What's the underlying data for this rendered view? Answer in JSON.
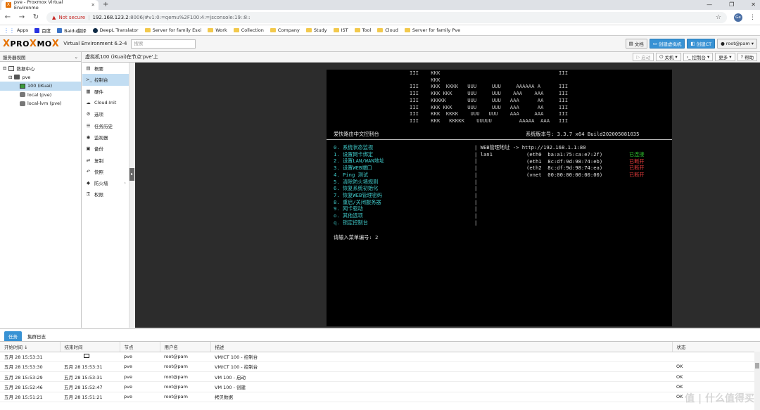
{
  "browser": {
    "tab_title": "pve - Proxmox Virtual Environme",
    "security_label": "Not secure",
    "url_host": "192.168.123.2",
    "url_rest": ":8006/#v1:0:=qemu%2F100:4:=jsconsole:19::8::",
    "profile_initials": "Ge",
    "bookmarks": [
      "Apps",
      "百度",
      "Baidu翻译",
      "DeepL Translator",
      "Server for family Esxi",
      "Work",
      "Collection",
      "Company",
      "Study",
      "IST",
      "Tool",
      "Cloud",
      "Server for family Pve"
    ]
  },
  "header": {
    "logo_left": "PRO",
    "logo_x": "X",
    "logo_mid": "MO",
    "logo_x2": "X",
    "version": "Virtual Environment 6.2-4",
    "search_placeholder": "搜索",
    "docs": "文档",
    "create_vm": "创建虚拟机",
    "create_ct": "创建CT",
    "user": "root@pam"
  },
  "tree": {
    "view_label": "服务器视图",
    "items": [
      {
        "label": "数据中心"
      },
      {
        "label": "pve"
      },
      {
        "label": "100 (iKuai)"
      },
      {
        "label": "local (pve)"
      },
      {
        "label": "local-lvm (pve)"
      }
    ]
  },
  "content": {
    "title": "虚拟机100 (iKuai)在节点'pve'上",
    "buttons": {
      "start": "启动",
      "shutdown": "关机",
      "console": "控制台",
      "more": "更多",
      "help": "帮助"
    }
  },
  "menu": [
    {
      "label": "概要",
      "icon": "▤"
    },
    {
      "label": "控制台",
      "icon": ">_"
    },
    {
      "label": "硬件",
      "icon": "▦"
    },
    {
      "label": "Cloud-Init",
      "icon": "☁"
    },
    {
      "label": "选项",
      "icon": "⚙"
    },
    {
      "label": "任务历史",
      "icon": "☰"
    },
    {
      "label": "监视器",
      "icon": "◉"
    },
    {
      "label": "备份",
      "icon": "▣"
    },
    {
      "label": "复制",
      "icon": "⇄"
    },
    {
      "label": "快照",
      "icon": "↶"
    },
    {
      "label": "防火墙",
      "icon": "◆"
    },
    {
      "label": "权限",
      "icon": "⚿"
    }
  ],
  "terminal": {
    "banner": [
      "III    KKK                                       III",
      "       KKK",
      "III    KKK  KKKK   UUU     UUU     AAAAAA A      III",
      "III    KKK KKK     UUU     UUU    AAA    AAA     III",
      "III    KKKKK       UUU     UUU   AAA      AA     III",
      "III    KKK KKK     UUU     UUU   AAA      AA     III",
      "III    KKK  KKKK    UUU   UUU    AAA     AAA     III",
      "III    KKK   KKKKK    UUUUU         AAAAA  AAA   III"
    ],
    "title_left": "爱快路由中文控制台",
    "title_right": "系统版本号: 3.3.7 x64 Build202005081035",
    "menu_items": [
      {
        "key": "0.",
        "text": "系统状态监视"
      },
      {
        "key": "1.",
        "text": "设置网卡绑定"
      },
      {
        "key": "2.",
        "text": "设置LAN/WAN地址"
      },
      {
        "key": "3.",
        "text": "设置WEB端口"
      },
      {
        "key": "4.",
        "text": "Ping 测试"
      },
      {
        "key": "5.",
        "text": "清除防火墙规则"
      },
      {
        "key": "6.",
        "text": "恢复系统初始化"
      },
      {
        "key": "7.",
        "text": "恢复WEB管理密码"
      },
      {
        "key": "8.",
        "text": "重启/关闭服务器"
      },
      {
        "key": "9.",
        "text": "网卡驱动"
      },
      {
        "key": "o.",
        "text": "其他选项"
      },
      {
        "key": "q.",
        "text": "锁定控制台"
      }
    ],
    "web_addr": "| WEB管理地址 -> http://192.168.1.1:80",
    "lan_label": "lan1",
    "nics": [
      {
        "name": "(eth0  ba:a1:75:ca:e7:2f)",
        "status": "已连接"
      },
      {
        "name": "(eth1  8c:df:9d:98:74:eb)",
        "status": "已断开"
      },
      {
        "name": "(eth2  8c:df:9d:98:74:ea)",
        "status": "已断开"
      },
      {
        "name": "(vnet  00:00:00:00:00:00)",
        "status": "已断开"
      }
    ],
    "prompt": "请输入菜单编号: 2"
  },
  "tasks": {
    "tab_tasks": "任务",
    "tab_cluster": "集群日志",
    "columns": [
      "开始时间 ↓",
      "结束时间",
      "节点",
      "用户名",
      "描述",
      "状态"
    ],
    "rows": [
      {
        "start": "五月 28 15:53:31",
        "end": "",
        "node": "pve",
        "user": "root@pam",
        "desc": "VM/CT 100 - 控制台",
        "status": ""
      },
      {
        "start": "五月 28 15:53:30",
        "end": "五月 28 15:53:31",
        "node": "pve",
        "user": "root@pam",
        "desc": "VM/CT 100 - 控制台",
        "status": "OK"
      },
      {
        "start": "五月 28 15:53:29",
        "end": "五月 28 15:53:31",
        "node": "pve",
        "user": "root@pam",
        "desc": "VM 100 - 启动",
        "status": "OK"
      },
      {
        "start": "五月 28 15:52:46",
        "end": "五月 28 15:52:47",
        "node": "pve",
        "user": "root@pam",
        "desc": "VM 100 - 创建",
        "status": "OK"
      },
      {
        "start": "五月 28 15:51:21",
        "end": "五月 28 15:51:21",
        "node": "pve",
        "user": "root@pam",
        "desc": "拷贝数据",
        "status": "OK"
      }
    ]
  },
  "watermark": "值 | 什么值得买"
}
